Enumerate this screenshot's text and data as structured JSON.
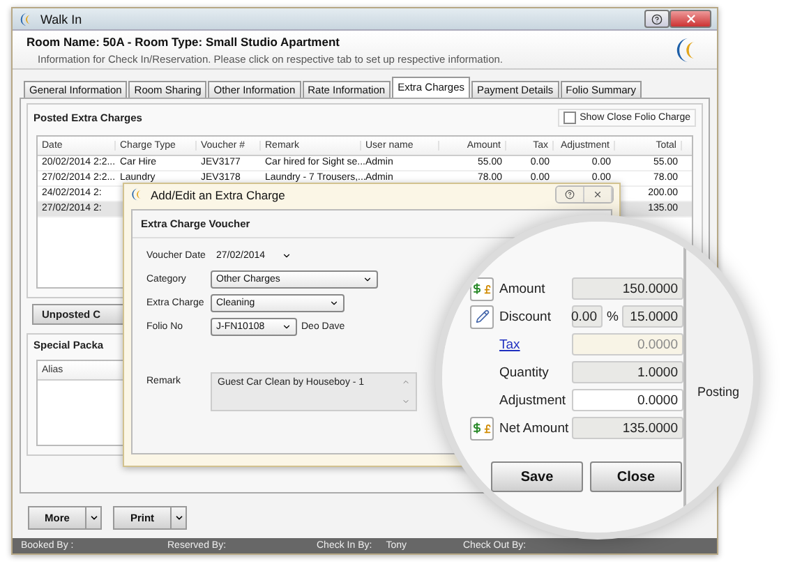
{
  "window": {
    "title": "Walk In"
  },
  "header": {
    "title": "Room Name: 50A - Room Type: Small Studio Apartment",
    "subtitle": "Information for Check In/Reservation. Please click on respective tab to set up respective information."
  },
  "tabs": [
    {
      "label": "General Information",
      "selected": false
    },
    {
      "label": "Room Sharing",
      "selected": false
    },
    {
      "label": "Other Information",
      "selected": false
    },
    {
      "label": "Rate Information",
      "selected": false
    },
    {
      "label": "Extra Charges",
      "selected": true
    },
    {
      "label": "Payment Details",
      "selected": false
    },
    {
      "label": "Folio Summary",
      "selected": false
    }
  ],
  "posted_charges": {
    "title": "Posted Extra Charges",
    "show_close_folio": {
      "label": "Show Close Folio Charge",
      "checked": false
    },
    "columns": [
      "Date",
      "Charge Type",
      "Voucher #",
      "Remark",
      "User name",
      "Amount",
      "Tax",
      "Adjustment",
      "Total"
    ],
    "rows": [
      {
        "selected": false,
        "cells": [
          "20/02/2014 2:2...",
          "Car Hire",
          "JEV3177",
          "Car hired for Sight se...",
          "Admin",
          "55.00",
          "0.00",
          "0.00",
          "55.00"
        ]
      },
      {
        "selected": false,
        "cells": [
          "27/02/2014 2:2...",
          "Laundry",
          "JEV3178",
          "Laundry - 7 Trousers,...",
          "Admin",
          "78.00",
          "0.00",
          "0.00",
          "78.00"
        ]
      },
      {
        "selected": false,
        "cells": [
          "24/02/2014 2:",
          null,
          null,
          null,
          null,
          null,
          null,
          null,
          "200.00"
        ]
      },
      {
        "selected": true,
        "cells": [
          "27/02/2014 2:",
          null,
          null,
          null,
          null,
          null,
          null,
          null,
          "135.00"
        ]
      }
    ]
  },
  "unposted_button": {
    "label": "Unposted C"
  },
  "special_packages": {
    "title": "Special Packa",
    "columns": [
      "Alias"
    ]
  },
  "footer_buttons": [
    {
      "label": "More"
    },
    {
      "label": "Print"
    }
  ],
  "status_bar": [
    {
      "label": "Booked By :"
    },
    {
      "label": "Reserved By:"
    },
    {
      "label": "Check In By:",
      "value": "Tony"
    },
    {
      "label": "Check Out By:"
    }
  ],
  "dialog": {
    "title": "Add/Edit an Extra Charge",
    "section": "Extra Charge Voucher",
    "fields": [
      {
        "kind": "date",
        "label": "Voucher Date",
        "value": "27/02/2014"
      },
      {
        "kind": "dropdown",
        "label": "Category",
        "value": "Other Charges"
      },
      {
        "kind": "dropdown",
        "label": "Extra Charge",
        "value": "Cleaning"
      },
      {
        "kind": "folio",
        "label": "Folio No",
        "value": "J-FN10108",
        "note": "Deo Dave"
      },
      {
        "kind": "textarea",
        "label": "Remark",
        "value": "Guest Car Clean by Houseboy - 1"
      }
    ]
  },
  "magnifier": {
    "amounts": [
      {
        "kind": "currency",
        "label": "Amount",
        "value": "150.0000",
        "editable": false,
        "disabled": false
      },
      {
        "kind": "discount",
        "label": "Discount",
        "percent": "0.00",
        "percent_sign": "%",
        "value": "15.0000",
        "editable": false,
        "disabled": false
      },
      {
        "kind": "link",
        "label": "Tax",
        "value": "0.0000",
        "editable": false,
        "disabled": true
      },
      {
        "kind": "plain",
        "label": "Quantity",
        "value": "1.0000",
        "editable": false,
        "disabled": false
      },
      {
        "kind": "plain",
        "label": "Adjustment",
        "value": "0.0000",
        "editable": true,
        "disabled": false
      },
      {
        "kind": "currency",
        "label": "Net Amount",
        "value": "135.0000",
        "editable": false,
        "disabled": false
      }
    ],
    "buttons": [
      {
        "label": "Save"
      },
      {
        "label": "Close"
      }
    ],
    "background_column": "Posting"
  }
}
